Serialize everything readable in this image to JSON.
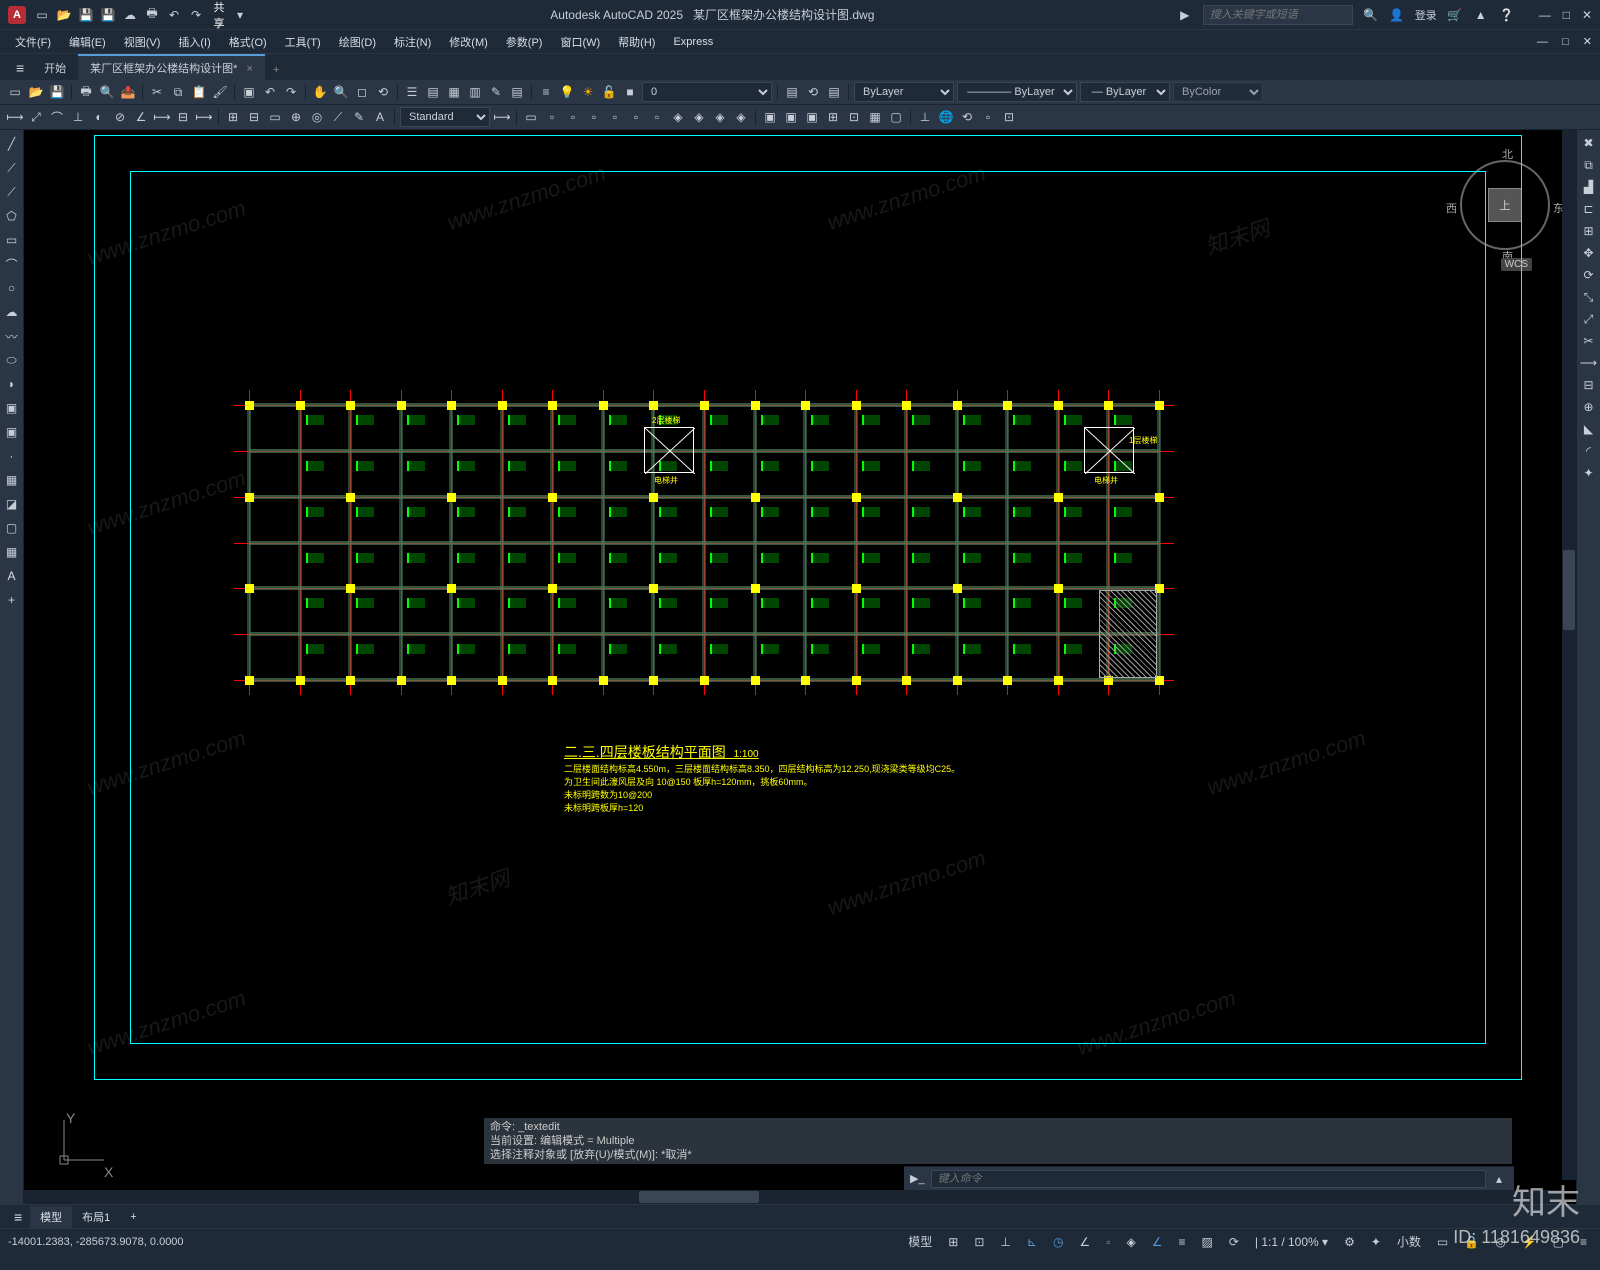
{
  "app": {
    "name": "Autodesk AutoCAD 2025",
    "file_in_title": "某厂区框架办公楼结构设计图.dwg",
    "logo_letter": "A"
  },
  "qat_share": "共享",
  "search": {
    "placeholder": "搜入关键字或短语"
  },
  "user": {
    "login": "登录"
  },
  "win": {
    "min": "—",
    "max": "□",
    "close": "✕"
  },
  "menu": [
    "文件(F)",
    "编辑(E)",
    "视图(V)",
    "插入(I)",
    "格式(O)",
    "工具(T)",
    "绘图(D)",
    "标注(N)",
    "修改(M)",
    "参数(P)",
    "窗口(W)",
    "帮助(H)",
    "Express"
  ],
  "filetabs": {
    "start": "开始",
    "active": "某厂区框架办公楼结构设计图*",
    "close": "×",
    "plus": "+"
  },
  "layers": {
    "current_layer": "0",
    "linetype": "ByLayer",
    "lineweight": "ByLayer",
    "plotstyle": "ByColor",
    "color": "ByLayer"
  },
  "textstyle": {
    "value": "Standard"
  },
  "viewcube": {
    "n": "北",
    "s": "南",
    "e": "东",
    "w": "西",
    "top": "上",
    "wcs": "WCS"
  },
  "ucs": {
    "x": "X",
    "y": "Y"
  },
  "drawing": {
    "title": "二.三.四层楼板结构平面图",
    "scale": "1:100",
    "notes": [
      "二层楼面结构标高4.550m，三层楼面结构标高8.350，四层结构标高为12.250,现浇梁类等级均C25。",
      "为卫生间此濠风层及向 10@150   板厚h=120mm，挑板60mm。",
      "未标明跨数为10@200",
      "未标明跨板厚h=120"
    ],
    "shaft1": "电梯井",
    "stair2": "2层楼梯",
    "stair1": "1层楼梯"
  },
  "commandline": {
    "history": [
      "命令: _textedit",
      "当前设置: 编辑模式 = Multiple",
      "选择注释对象或 [放弃(U)/模式(M)]: *取消*"
    ],
    "prompt_placeholder": "键入命令"
  },
  "layouttabs": {
    "model": "模型",
    "layout1": "布局1",
    "plus": "+"
  },
  "status": {
    "coords": "-14001.2383, -285673.9078, 0.0000",
    "model_btn": "模型",
    "scale": "| 1:1 / 100% ▾",
    "decimal": "小数",
    "hamburger": "≡"
  },
  "watermark": {
    "zm": "www.znzmo.com",
    "brand": "知末",
    "brand2": "知末网",
    "id": "ID: 1181649836"
  }
}
